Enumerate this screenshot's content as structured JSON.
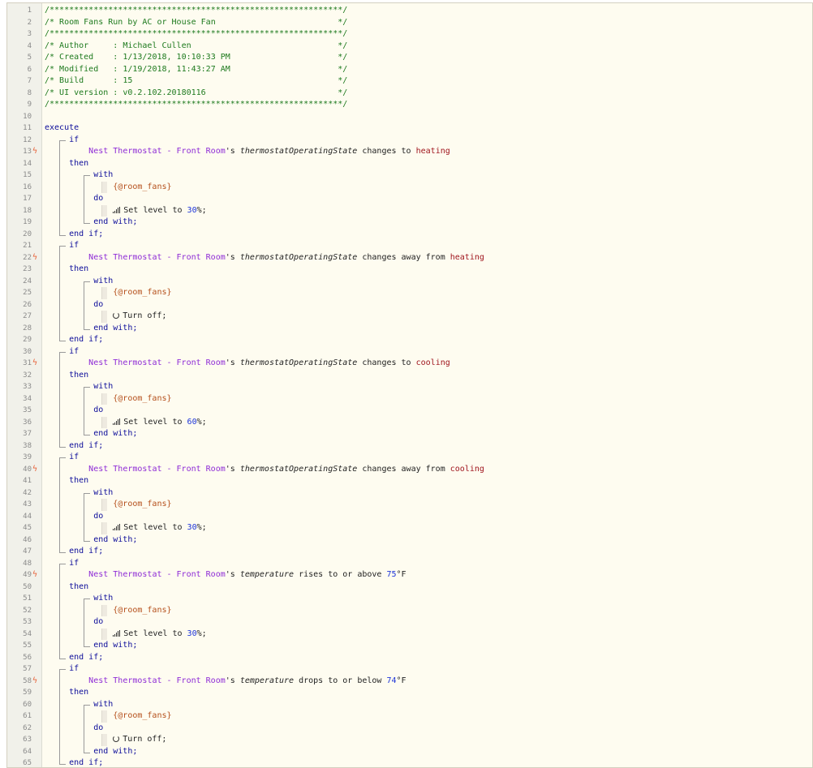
{
  "header_comments": [
    "/************************************************************/",
    "/* Room Fans Run by AC or House Fan                         */",
    "/************************************************************/",
    "/* Author     : Michael Cullen                              */",
    "/* Created    : 1/13/2018, 10:10:33 PM                      */",
    "/* Modified   : 1/19/2018, 11:43:27 AM                      */",
    "/* Build      : 15                                          */",
    "/* UI version : v0.2.102.20180116                           */",
    "/************************************************************/"
  ],
  "keywords": {
    "execute": "execute",
    "if": "if",
    "then": "then",
    "with": "with",
    "do": "do",
    "end_with": "end with;",
    "end_if": "end if;"
  },
  "target_var": "{@room_fans}",
  "device_name": "Nest Thermostat - Front Room",
  "possessive": "'s",
  "blocks": [
    {
      "attribute": "thermostatOperatingState",
      "op": "changes to",
      "value": "heating",
      "value_type": "string",
      "action": "Set level to",
      "level": "30",
      "action_icon": "signal-level-icon"
    },
    {
      "attribute": "thermostatOperatingState",
      "op": "changes away from",
      "value": "heating",
      "value_type": "string",
      "action": "Turn off;",
      "level": null,
      "action_icon": "power-off-icon"
    },
    {
      "attribute": "thermostatOperatingState",
      "op": "changes to",
      "value": "cooling",
      "value_type": "string",
      "action": "Set level to",
      "level": "60",
      "action_icon": "signal-level-icon"
    },
    {
      "attribute": "thermostatOperatingState",
      "op": "changes away from",
      "value": "cooling",
      "value_type": "string",
      "action": "Set level to",
      "level": "30",
      "action_icon": "signal-level-icon"
    },
    {
      "attribute": "temperature",
      "op": "rises to or above",
      "value": "75",
      "unit": "°F",
      "value_type": "number",
      "action": "Set level to",
      "level": "30",
      "action_icon": "signal-level-icon"
    },
    {
      "attribute": "temperature",
      "op": "drops to or below",
      "value": "74",
      "unit": "°F",
      "value_type": "number",
      "action": "Turn off;",
      "level": null,
      "action_icon": "power-off-icon"
    }
  ],
  "percent_suffix": "%;",
  "colors": {
    "background": "#fefcf0",
    "comment": "#1e7a1e",
    "keyword": "#0d0d9a",
    "device": "#8e2bd6",
    "variable": "#b5501c",
    "string_value": "#a0161e",
    "number": "#1c33d8",
    "trigger_bolt": "#e8643c"
  }
}
